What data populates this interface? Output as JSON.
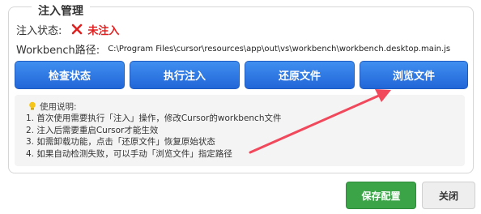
{
  "group": {
    "title": "注入管理"
  },
  "status": {
    "label": "注入状态:",
    "icon": "x-icon",
    "value": "未注入",
    "value_color": "#e02020"
  },
  "path": {
    "label": "Workbench路径:",
    "value": "C:\\Program Files\\cursor\\resources\\app\\out\\vs\\workbench\\workbench.desktop.main.js"
  },
  "buttons": {
    "check": "检查状态",
    "inject": "执行注入",
    "restore": "还原文件",
    "browse": "浏览文件"
  },
  "help": {
    "icon": "lightbulb-icon",
    "title": "使用说明:",
    "lines": [
      "1. 首次使用需要执行「注入」操作，修改Cursor的workbench文件",
      "2. 注入后需要重启Cursor才能生效",
      "3. 如需卸载功能，点击「还原文件」恢复原始状态",
      "4. 如果自动检测失败，可以手动「浏览文件」指定路径"
    ]
  },
  "footer": {
    "save": "保存配置",
    "close": "关闭"
  },
  "colors": {
    "primary_button": "#2f7be6",
    "save_button": "#3aa447",
    "annotation_arrow": "#f2485c"
  }
}
